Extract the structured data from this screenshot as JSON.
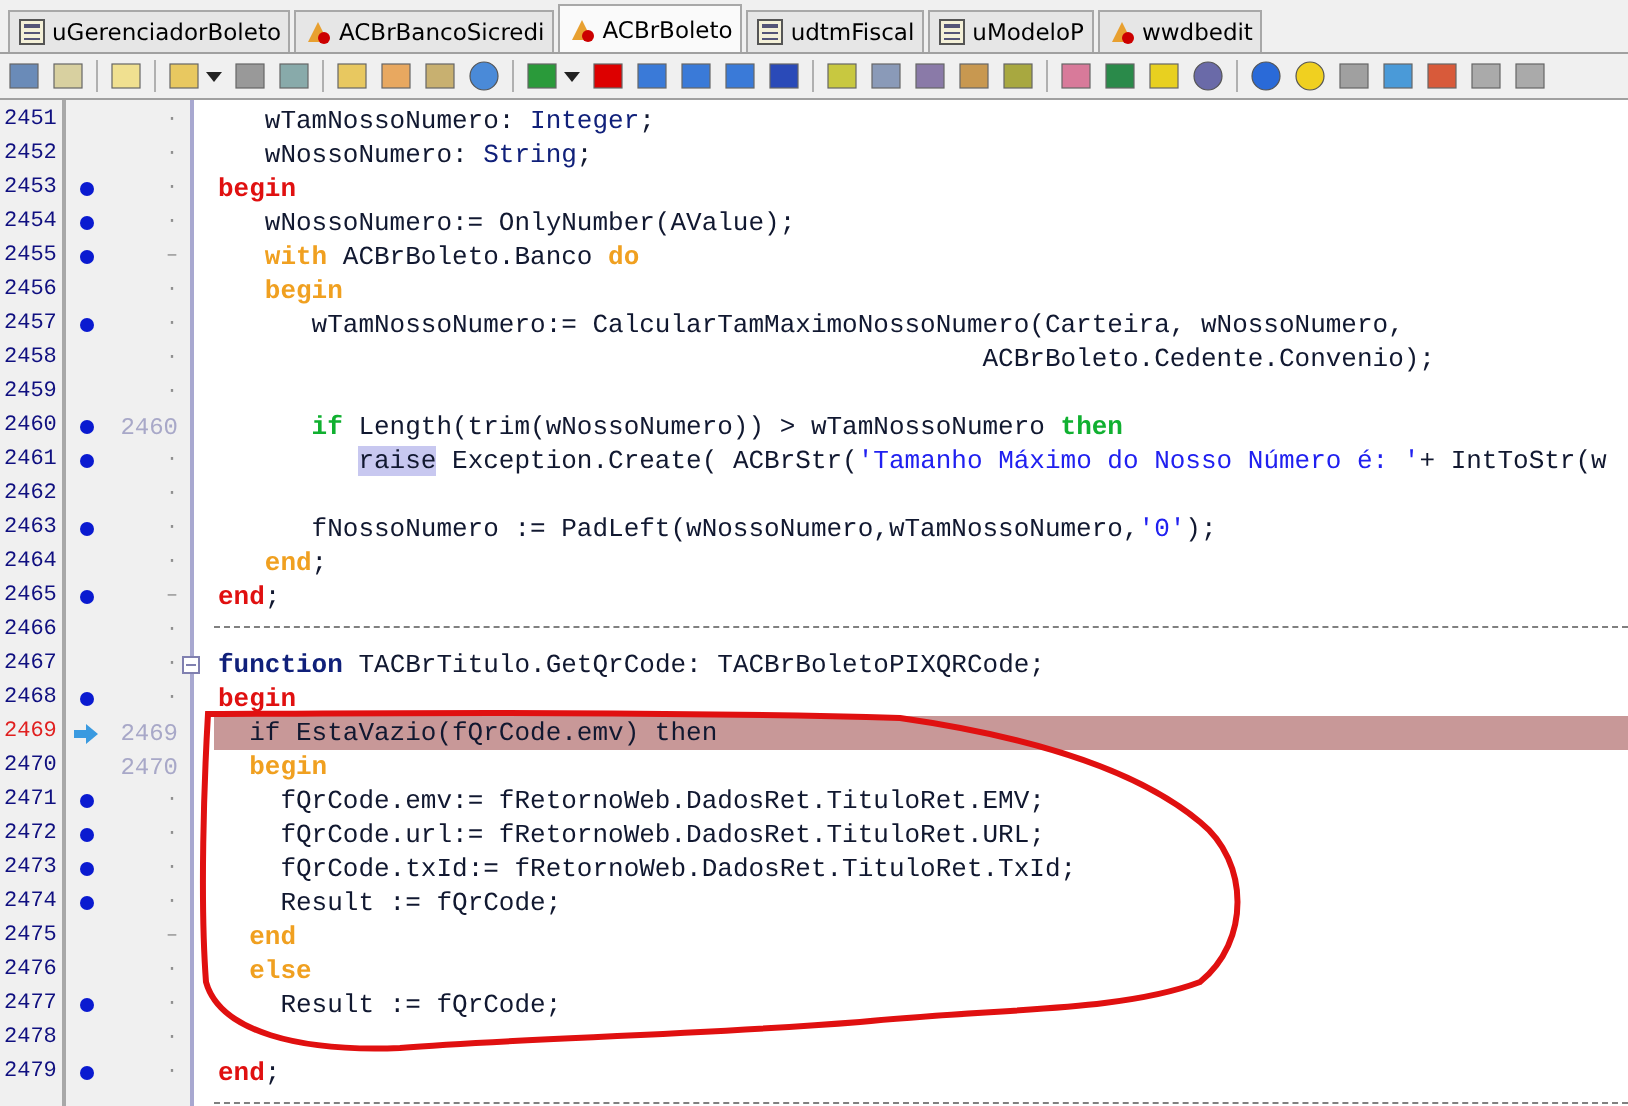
{
  "tabs": [
    {
      "label": "uGerenciadorBoleto",
      "selected": false,
      "kind": "form"
    },
    {
      "label": "ACBrBancoSicredi",
      "selected": false,
      "kind": "component"
    },
    {
      "label": "ACBrBoleto",
      "selected": true,
      "kind": "component"
    },
    {
      "label": "udtmFiscal",
      "selected": false,
      "kind": "form"
    },
    {
      "label": "uModeloP",
      "selected": false,
      "kind": "form"
    },
    {
      "label": "wwdbedit",
      "selected": false,
      "kind": "component"
    }
  ],
  "editor": {
    "lines": [
      {
        "number": "2451",
        "breakpoint": false,
        "current": false,
        "collapsible": false,
        "separator": false,
        "address": "·",
        "tokens": [
          {
            "text": "   wTamNossoNumero: ",
            "kind": "plain"
          },
          {
            "text": "Integer",
            "kind": "type"
          },
          {
            "text": ";",
            "kind": "plain"
          }
        ]
      },
      {
        "number": "2452",
        "breakpoint": false,
        "current": false,
        "collapsible": false,
        "separator": false,
        "address": "·",
        "tokens": [
          {
            "text": "   wNossoNumero: ",
            "kind": "plain"
          },
          {
            "text": "String",
            "kind": "type"
          },
          {
            "text": ";",
            "kind": "plain"
          }
        ]
      },
      {
        "number": "2453",
        "breakpoint": true,
        "current": false,
        "collapsible": false,
        "separator": false,
        "address": "·",
        "tokens": [
          {
            "text": "begin",
            "kind": "block"
          }
        ]
      },
      {
        "number": "2454",
        "breakpoint": true,
        "current": false,
        "collapsible": false,
        "separator": false,
        "address": "·",
        "tokens": [
          {
            "text": "   wNossoNumero:= OnlyNumber(AValue);",
            "kind": "plain"
          }
        ]
      },
      {
        "number": "2455",
        "breakpoint": true,
        "current": false,
        "collapsible": false,
        "separator": false,
        "address": "–",
        "tokens": [
          {
            "text": "   with",
            "kind": "flow"
          },
          {
            "text": " ACBrBoleto.Banco ",
            "kind": "plain"
          },
          {
            "text": "do",
            "kind": "flow"
          }
        ]
      },
      {
        "number": "2456",
        "breakpoint": false,
        "current": false,
        "collapsible": false,
        "separator": false,
        "address": "·",
        "tokens": [
          {
            "text": "   begin",
            "kind": "flow"
          }
        ]
      },
      {
        "number": "2457",
        "breakpoint": true,
        "current": false,
        "collapsible": false,
        "separator": false,
        "address": "·",
        "tokens": [
          {
            "text": "      wTamNossoNumero:= CalcularTamMaximoNossoNumero(Carteira, wNossoNumero,",
            "kind": "plain"
          }
        ]
      },
      {
        "number": "2458",
        "breakpoint": false,
        "current": false,
        "collapsible": false,
        "separator": false,
        "address": "·",
        "tokens": [
          {
            "text": "                                                 ACBrBoleto.Cedente.Convenio);",
            "kind": "plain"
          }
        ]
      },
      {
        "number": "2459",
        "breakpoint": false,
        "current": false,
        "collapsible": false,
        "separator": false,
        "address": "·"
      },
      {
        "number": "2460",
        "breakpoint": true,
        "current": false,
        "collapsible": false,
        "separator": false,
        "address": "2460",
        "tokens": [
          {
            "text": "      if",
            "kind": "cond"
          },
          {
            "text": " Length(trim(wNossoNumero)) > wTamNossoNumero ",
            "kind": "plain"
          },
          {
            "text": "then",
            "kind": "cond"
          }
        ]
      },
      {
        "number": "2461",
        "breakpoint": true,
        "current": false,
        "collapsible": false,
        "separator": false,
        "address": "·",
        "tokens": [
          {
            "text": "         raise",
            "kind": "marked"
          },
          {
            "text": " Exception.Create( ACBrStr(",
            "kind": "plain"
          },
          {
            "text": "'Tamanho Máximo do Nosso Número é: '",
            "kind": "string"
          },
          {
            "text": "+ IntToStr(w",
            "kind": "plain"
          }
        ]
      },
      {
        "number": "2462",
        "breakpoint": false,
        "current": false,
        "collapsible": false,
        "separator": false,
        "address": "·"
      },
      {
        "number": "2463",
        "breakpoint": true,
        "current": false,
        "collapsible": false,
        "separator": false,
        "address": "·",
        "tokens": [
          {
            "text": "      fNossoNumero := PadLeft(wNossoNumero,wTamNossoNumero,",
            "kind": "plain"
          },
          {
            "text": "'0'",
            "kind": "string"
          },
          {
            "text": ");",
            "kind": "plain"
          }
        ]
      },
      {
        "number": "2464",
        "breakpoint": false,
        "current": false,
        "collapsible": false,
        "separator": false,
        "address": "·",
        "tokens": [
          {
            "text": "   end",
            "kind": "flow"
          },
          {
            "text": ";",
            "kind": "plain"
          }
        ]
      },
      {
        "number": "2465",
        "breakpoint": true,
        "current": false,
        "collapsible": false,
        "separator": false,
        "address": "–",
        "tokens": [
          {
            "text": "end",
            "kind": "block"
          },
          {
            "text": ";",
            "kind": "plain"
          }
        ]
      },
      {
        "number": "2466",
        "breakpoint": false,
        "current": false,
        "collapsible": false,
        "separator": true,
        "address": "·"
      },
      {
        "number": "2467",
        "breakpoint": false,
        "current": false,
        "collapsible": true,
        "separator": false,
        "address": "·",
        "tokens": [
          {
            "text": "function",
            "kind": "decl"
          },
          {
            "text": " TACBrTitulo.GetQrCode: TACBrBoletoPIXQRCode;",
            "kind": "plain"
          }
        ]
      },
      {
        "number": "2468",
        "breakpoint": true,
        "current": false,
        "collapsible": false,
        "separator": false,
        "address": "·",
        "tokens": [
          {
            "text": "begin",
            "kind": "block"
          }
        ]
      },
      {
        "number": "2469",
        "breakpoint": false,
        "current": true,
        "collapsible": false,
        "separator": false,
        "address": "2469",
        "tokens": [
          {
            "text": "  if EstaVazio(fQrCode.emv) then",
            "kind": "plain"
          }
        ]
      },
      {
        "number": "2470",
        "breakpoint": false,
        "current": false,
        "collapsible": false,
        "separator": false,
        "address": "2470",
        "tokens": [
          {
            "text": "  begin",
            "kind": "flow"
          }
        ]
      },
      {
        "number": "2471",
        "breakpoint": true,
        "current": false,
        "collapsible": false,
        "separator": false,
        "address": "·",
        "tokens": [
          {
            "text": "    fQrCode.emv:= fRetornoWeb.DadosRet.TituloRet.EMV;",
            "kind": "plain"
          }
        ]
      },
      {
        "number": "2472",
        "breakpoint": true,
        "current": false,
        "collapsible": false,
        "separator": false,
        "address": "·",
        "tokens": [
          {
            "text": "    fQrCode.url:= fRetornoWeb.DadosRet.TituloRet.URL;",
            "kind": "plain"
          }
        ]
      },
      {
        "number": "2473",
        "breakpoint": true,
        "current": false,
        "collapsible": false,
        "separator": false,
        "address": "·",
        "tokens": [
          {
            "text": "    fQrCode.txId:= fRetornoWeb.DadosRet.TituloRet.TxId;",
            "kind": "plain"
          }
        ]
      },
      {
        "number": "2474",
        "breakpoint": true,
        "current": false,
        "collapsible": false,
        "separator": false,
        "address": "·",
        "tokens": [
          {
            "text": "    Result := fQrCode;",
            "kind": "plain"
          }
        ]
      },
      {
        "number": "2475",
        "breakpoint": false,
        "current": false,
        "collapsible": false,
        "separator": false,
        "address": "–",
        "tokens": [
          {
            "text": "  end",
            "kind": "flow"
          }
        ]
      },
      {
        "number": "2476",
        "breakpoint": false,
        "current": false,
        "collapsible": false,
        "separator": false,
        "address": "·",
        "tokens": [
          {
            "text": "  else",
            "kind": "flow"
          }
        ]
      },
      {
        "number": "2477",
        "breakpoint": true,
        "current": false,
        "collapsible": false,
        "separator": false,
        "address": "·",
        "tokens": [
          {
            "text": "    Result := fQrCode;",
            "kind": "plain"
          }
        ]
      },
      {
        "number": "2478",
        "breakpoint": false,
        "current": false,
        "collapsible": false,
        "separator": false,
        "address": "·"
      },
      {
        "number": "2479",
        "breakpoint": true,
        "current": false,
        "collapsible": false,
        "separator": false,
        "address": "·",
        "tokens": [
          {
            "text": "end",
            "kind": "block"
          },
          {
            "text": ";",
            "kind": "plain"
          }
        ]
      },
      {
        "breakpoint": false,
        "current": false,
        "collapsible": false,
        "separator": true
      }
    ]
  }
}
